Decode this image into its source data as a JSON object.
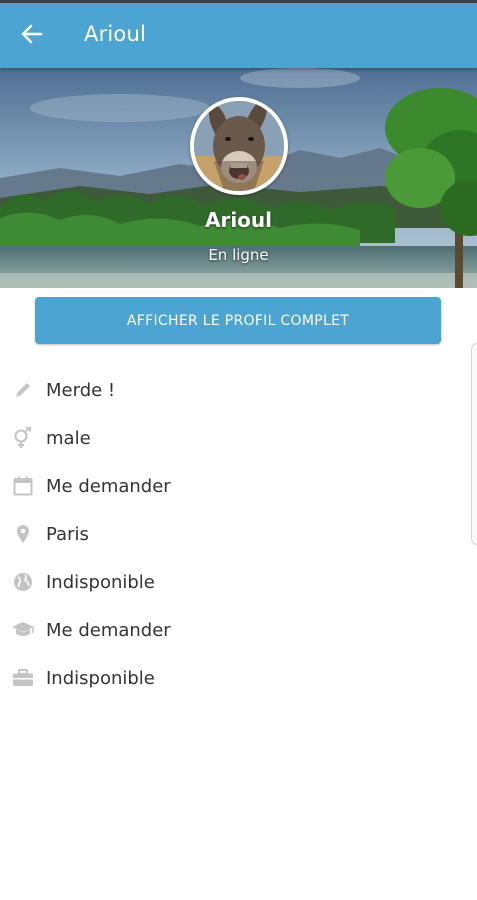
{
  "appbar": {
    "title": "Arioul",
    "back_icon": "arrow-left-icon",
    "color": "#4ba4d1"
  },
  "profile": {
    "name": "Arioul",
    "status": "En ligne"
  },
  "actions": {
    "full_profile_label": "AFFICHER LE PROFIL COMPLET"
  },
  "info": {
    "items": [
      {
        "icon": "pencil-icon",
        "value": "Merde !"
      },
      {
        "icon": "gender-icon",
        "value": "male"
      },
      {
        "icon": "calendar-icon",
        "value": "Me demander"
      },
      {
        "icon": "location-pin-icon",
        "value": "Paris"
      },
      {
        "icon": "globe-icon",
        "value": "Indisponible"
      },
      {
        "icon": "graduation-cap-icon",
        "value": "Me demander"
      },
      {
        "icon": "briefcase-icon",
        "value": "Indisponible"
      }
    ]
  },
  "colors": {
    "accent": "#4ba4d1",
    "icon_gray": "#c4c4c4",
    "text": "#333333"
  }
}
